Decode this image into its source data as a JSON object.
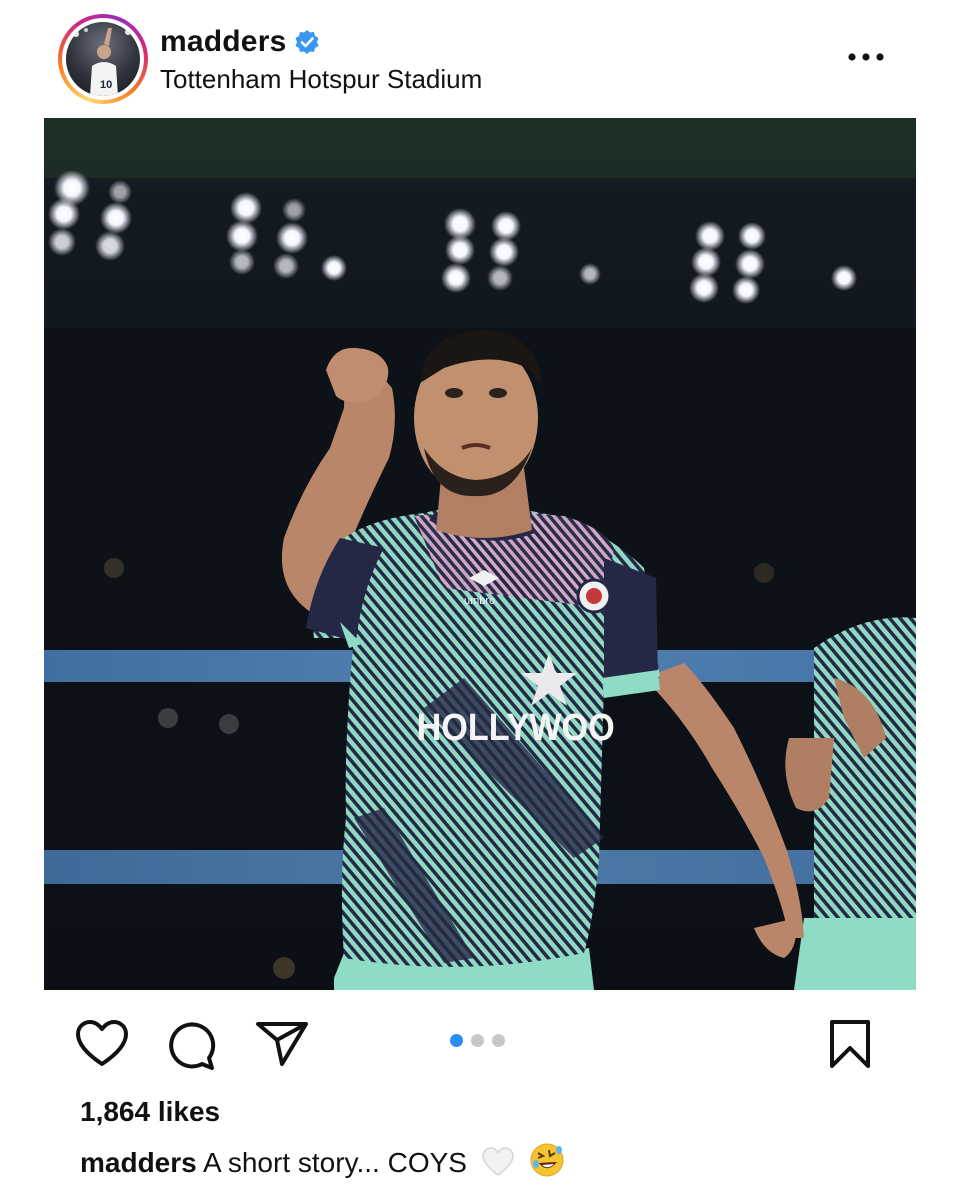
{
  "post": {
    "username": "madders",
    "verified": true,
    "location": "Tottenham Hotspur Stadium",
    "more_label": "More options"
  },
  "media": {
    "carousel_count": 3,
    "carousel_active_index": 0,
    "jersey_sponsor_text": "HOLLYWOO",
    "jersey_brand_text": "umbro"
  },
  "actions": {
    "like_icon": "heart-outline-icon",
    "comment_icon": "comment-bubble-icon",
    "share_icon": "paper-plane-icon",
    "save_icon": "bookmark-outline-icon"
  },
  "engagement": {
    "likes_text": "1,864 likes"
  },
  "caption": {
    "username": "madders",
    "text": "A short story... COYS",
    "emojis": [
      "white-heart-icon",
      "rolling-laughing-face-icon"
    ]
  },
  "colors": {
    "verified_blue": "#3897f0",
    "active_dot": "#2b8df2",
    "inactive_dot": "#c7c7c7",
    "jersey_navy": "#252845",
    "jersey_mint": "#8fd9c3",
    "jersey_pink": "#d8a8c8"
  }
}
